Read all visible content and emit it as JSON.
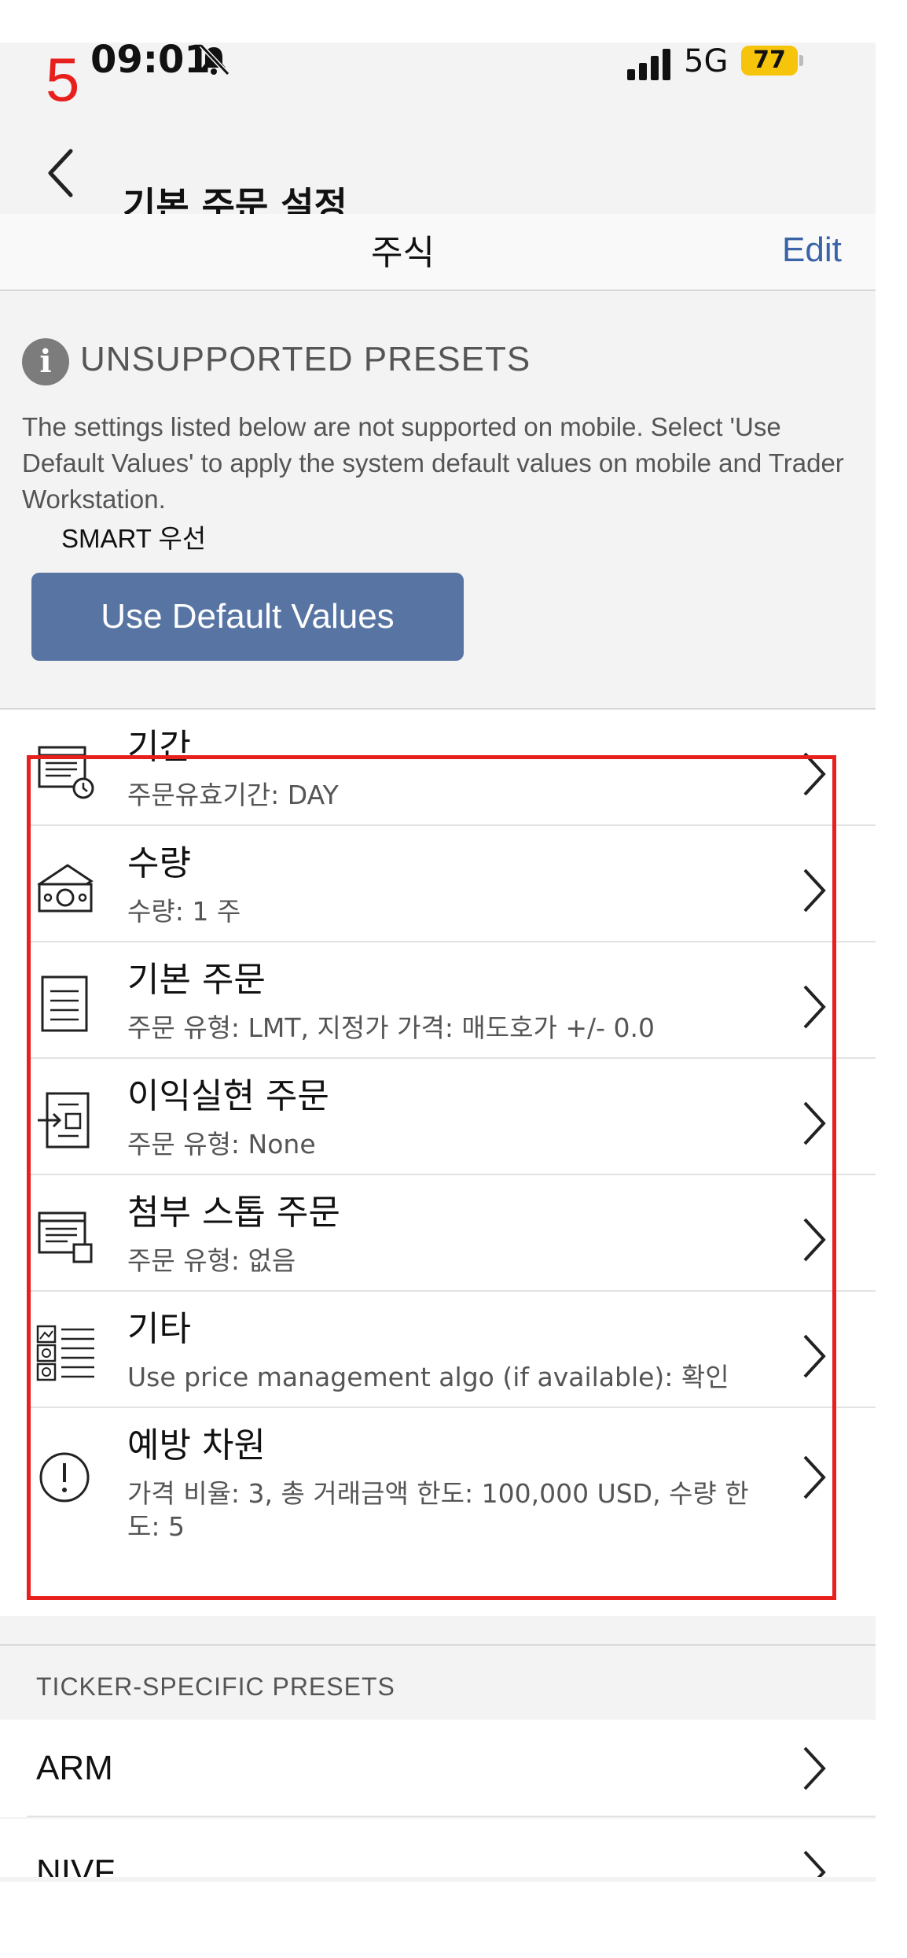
{
  "annotation": {
    "step_number": "5"
  },
  "status_bar": {
    "time": "09:01",
    "network": "5G",
    "battery": "77",
    "icons": [
      "bell-slash-icon",
      "signal-bars-icon"
    ]
  },
  "nav": {
    "title": "기본 주문 설정",
    "back_icon": "chevron-left-icon"
  },
  "segment": {
    "title": "주식",
    "edit_label": "Edit"
  },
  "unsupported": {
    "icon": "info-icon",
    "icon_glyph": "i",
    "title": "UNSUPPORTED PRESETS",
    "description": "The settings listed below are not supported on mobile. Select 'Use Default Values' to apply the system default values on mobile and Trader Workstation.",
    "item": "SMART 우선",
    "button_label": "Use Default Values"
  },
  "presets": [
    {
      "icon": "calendar-clock-icon",
      "title": "기간",
      "subtitle": "주문유효기간: DAY"
    },
    {
      "icon": "money-stack-icon",
      "title": "수량",
      "subtitle": "수량: 1 주"
    },
    {
      "icon": "document-list-icon",
      "title": "기본 주문",
      "subtitle": "주문 유형: LMT, 지정가 가격: 매도호가 +/- 0.0"
    },
    {
      "icon": "profit-order-icon",
      "title": "이익실현 주문",
      "subtitle": "주문 유형: None"
    },
    {
      "icon": "attached-stop-icon",
      "title": "첨부 스톱 주문",
      "subtitle": "주문 유형: 없음"
    },
    {
      "icon": "misc-list-icon",
      "title": "기타",
      "subtitle": "Use price management algo (if available): 확인"
    },
    {
      "icon": "exclamation-circle-icon",
      "title": "예방 차원",
      "subtitle": "가격 비율: 3, 총 거래금액 한도: 100,000 USD, 수량 한도: 5"
    }
  ],
  "ticker_presets": {
    "title": "TICKER-SPECIFIC PRESETS",
    "items": [
      {
        "name": "ARM"
      },
      {
        "name": "NIVF"
      }
    ]
  },
  "colors": {
    "accent": "#3a63a8",
    "button": "#5774a3",
    "annotation": "#e8201d",
    "battery": "#f6c40a"
  }
}
